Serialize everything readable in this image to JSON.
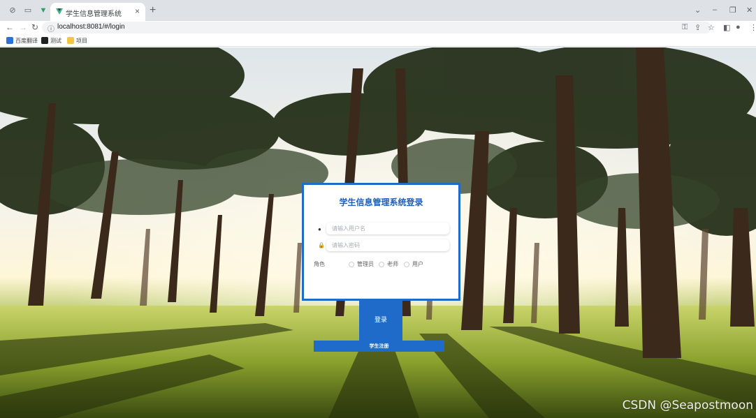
{
  "browser": {
    "tab_title": "学生信息管理系统",
    "tab_close": "×",
    "new_tab": "+",
    "url": "localhost:8081/#/login",
    "window_controls": [
      "⌄",
      "–",
      "❐",
      "✕"
    ]
  },
  "bookmarks": [
    {
      "label": "百度翻译",
      "icon": "baidu-translate-icon",
      "color": "#2b71d9"
    },
    {
      "label": "测试",
      "icon": "folder-dark-icon",
      "color": "#202124"
    },
    {
      "label": "项目",
      "icon": "folder-icon",
      "color": "#f4c542"
    }
  ],
  "login": {
    "title": "学生信息管理系统登录",
    "username_placeholder": "请输入用户名",
    "password_placeholder": "请输入密码",
    "role_label": "角色",
    "roles": [
      "管理员",
      "老师",
      "用户"
    ],
    "login_button": "登录",
    "register_button": "学生注册"
  },
  "watermark": "CSDN @Seapostmoon",
  "colors": {
    "accent": "#1e6bc9",
    "title": "#1e5fb8"
  }
}
